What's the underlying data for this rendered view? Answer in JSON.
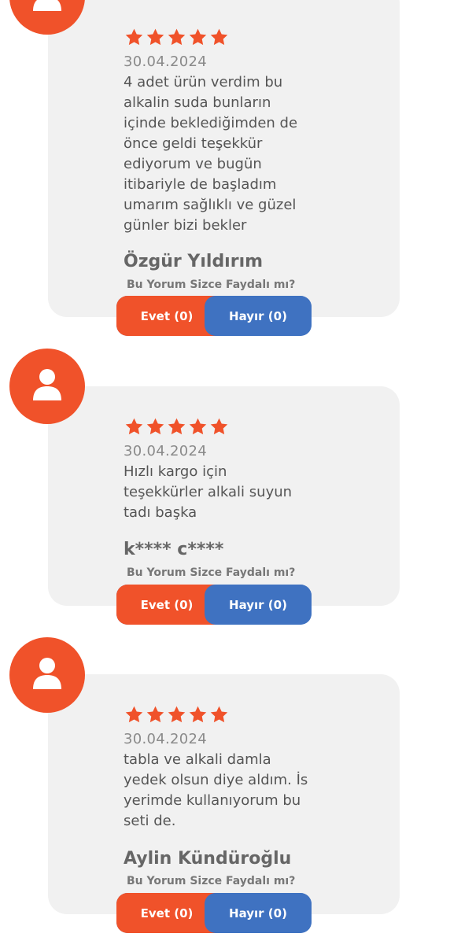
{
  "colors": {
    "accent": "#f0522a",
    "no_button": "#3f72c1",
    "card_bg": "#f1f1f1"
  },
  "reviews": [
    {
      "rating": 5,
      "date": "30.04.2024",
      "text": "4 adet ürün verdim bu\nalkalin suda bunların\niçinde beklediğimden de\nönce geldi teşekkür\nediyorum ve bugün\nitibariyle de başladım\numarım sağlıklı ve güzel\ngünler bizi bekler",
      "author": "Özgür Yıldırım",
      "helpful_label": "Bu Yorum Sizce Faydalı mı?",
      "yes_label": "Evet (0)",
      "no_label": "Hayır (0)"
    },
    {
      "rating": 5,
      "date": "30.04.2024",
      "text": "Hızlı kargo için\nteşekkürler alkali suyun\ntadı başka",
      "author": "k**** c****",
      "helpful_label": "Bu Yorum Sizce Faydalı mı?",
      "yes_label": "Evet (0)",
      "no_label": "Hayır (0)"
    },
    {
      "rating": 5,
      "date": "30.04.2024",
      "text": "tabla ve alkali damla\nyedek olsun diye aldım. İs\nyerimde kullanıyorum bu\nseti de.",
      "author": "Aylin Kündüroğlu",
      "helpful_label": "Bu Yorum Sizce Faydalı mı?",
      "yes_label": "Evet (0)",
      "no_label": "Hayır (0)"
    }
  ]
}
